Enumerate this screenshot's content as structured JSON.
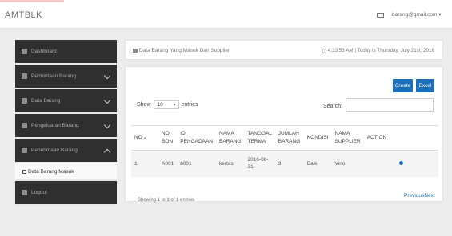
{
  "brand": "AMTBLK",
  "user_email": "barang@gmail.com ▾",
  "sidebar": {
    "items": [
      {
        "label": "Dashboard",
        "chevron": false
      },
      {
        "label": "Permintaan Barang",
        "chevron": true
      },
      {
        "label": "Data Barang",
        "chevron": true
      },
      {
        "label": "Pengeluaran Barang",
        "chevron": true
      },
      {
        "label": "Penerimaan Barang",
        "chevron": true,
        "expanded": true
      }
    ],
    "sub_item": "Data Barang Masuk",
    "logout": "Logout"
  },
  "breadcrumb": {
    "title": "Data Barang Yang Masuk Dari Supplier",
    "time": "4:33:53 AM | Today is Thursday, July 21st, 2016"
  },
  "buttons": {
    "create": "Create",
    "excel": "Excel"
  },
  "length": {
    "show_label": "Show",
    "value": "10",
    "entries_label": "entries"
  },
  "search": {
    "label": "Search:",
    "value": ""
  },
  "table": {
    "headers": [
      "NO",
      "NO BON",
      "ID PENGADAAN",
      "NAMA BARANG",
      "TANGGAL TERMA",
      "JUMLAH BARANG",
      "KONDISI",
      "NAMA SUPPLIER",
      "ACTION"
    ],
    "rows": [
      {
        "no": "1",
        "no_bon": "A001",
        "id_pengadaan": "b001",
        "nama_barang": "kertas",
        "tanggal": "2016-08-31",
        "jumlah": "3",
        "kondisi": "Baik",
        "supplier": "Vino"
      }
    ]
  },
  "footer": {
    "info": "Showing 1 to 1 of 1 entries",
    "pager": "PreviousNext"
  }
}
